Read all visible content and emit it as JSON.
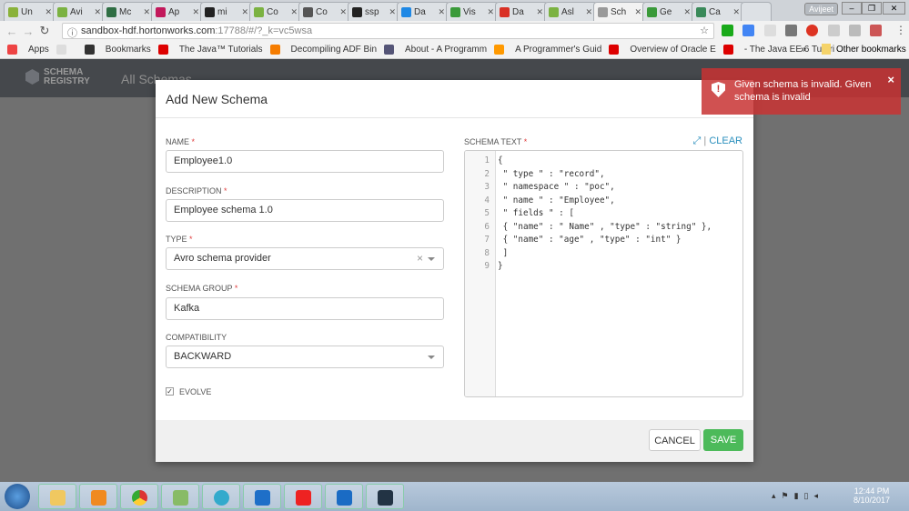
{
  "browser": {
    "tabs": [
      {
        "label": "Un",
        "color": "#8ab23a"
      },
      {
        "label": "Avi",
        "color": "#7bb241"
      },
      {
        "label": "Mc",
        "color": "#2f6e44"
      },
      {
        "label": "Ap",
        "color": "#c2185b"
      },
      {
        "label": "mi",
        "color": "#222"
      },
      {
        "label": "Co",
        "color": "#7bb241"
      },
      {
        "label": "Co",
        "color": "#555"
      },
      {
        "label": "ssp",
        "color": "#222"
      },
      {
        "label": "Da",
        "color": "#1e88e5"
      },
      {
        "label": "Vis",
        "color": "#3a9a3a"
      },
      {
        "label": "Da",
        "color": "#d93025"
      },
      {
        "label": "Asl",
        "color": "#7bb241"
      },
      {
        "label": "Sch",
        "color": "#999"
      },
      {
        "label": "Ge",
        "color": "#3a9a3a"
      },
      {
        "label": "Ca",
        "color": "#3a8a5a"
      }
    ],
    "user": "Avijeet",
    "url_host": "sandbox-hdf.hortonworks.com",
    "url_rest": ":17788/#/?_k=vc5wsa",
    "bookmarks": [
      {
        "label": "Apps",
        "color": "#e44"
      },
      {
        "label": "",
        "color": "#ddd"
      },
      {
        "label": "Bookmarks",
        "color": "#333"
      },
      {
        "label": "The Java™ Tutorials",
        "color": "#d00"
      },
      {
        "label": "Decompiling ADF Bin",
        "color": "#f57c00"
      },
      {
        "label": "About - A Programm",
        "color": "#557"
      },
      {
        "label": "A Programmer's Guid",
        "color": "#f90"
      },
      {
        "label": "Overview of Oracle E",
        "color": "#d00"
      },
      {
        "label": "- The Java EE 6 Tutori",
        "color": "#d00"
      }
    ],
    "other_bookmarks": "Other bookmarks",
    "more": "»"
  },
  "app": {
    "logo_line1": "SCHEMA",
    "logo_line2": "REGISTRY",
    "section": "All Schemas"
  },
  "modal": {
    "title": "Add New Schema",
    "name_label": "NAME",
    "name_value": "Employee1.0",
    "desc_label": "DESCRIPTION",
    "desc_value": "Employee schema 1.0",
    "type_label": "TYPE",
    "type_value": "Avro schema provider",
    "group_label": "SCHEMA GROUP",
    "group_value": "Kafka",
    "compat_label": "COMPATIBILITY",
    "compat_value": "BACKWARD",
    "evolve_label": "EVOLVE",
    "evolve_checked": true,
    "schema_label": "SCHEMA TEXT",
    "clear": "CLEAR",
    "sep": "|",
    "required": "*",
    "schema_lines": [
      "{",
      " \" type \" : \"record\",",
      " \" namespace \" : \"poc\",",
      " \" name \" : \"Employee\",",
      " \" fields \" : [",
      " { \"name\" : \" Name\" , \"type\" : \"string\" },",
      " { \"name\" : \"age\" , \"type\" : \"int\" }",
      " ]",
      "}"
    ],
    "cancel": "CANCEL",
    "save": "SAVE"
  },
  "toast": {
    "message": "Given schema is invalid. Given schema is invalid",
    "close": "×",
    "color": "#c83232"
  },
  "taskbar": {
    "time": "12:44 PM",
    "date": "8/10/2017"
  }
}
